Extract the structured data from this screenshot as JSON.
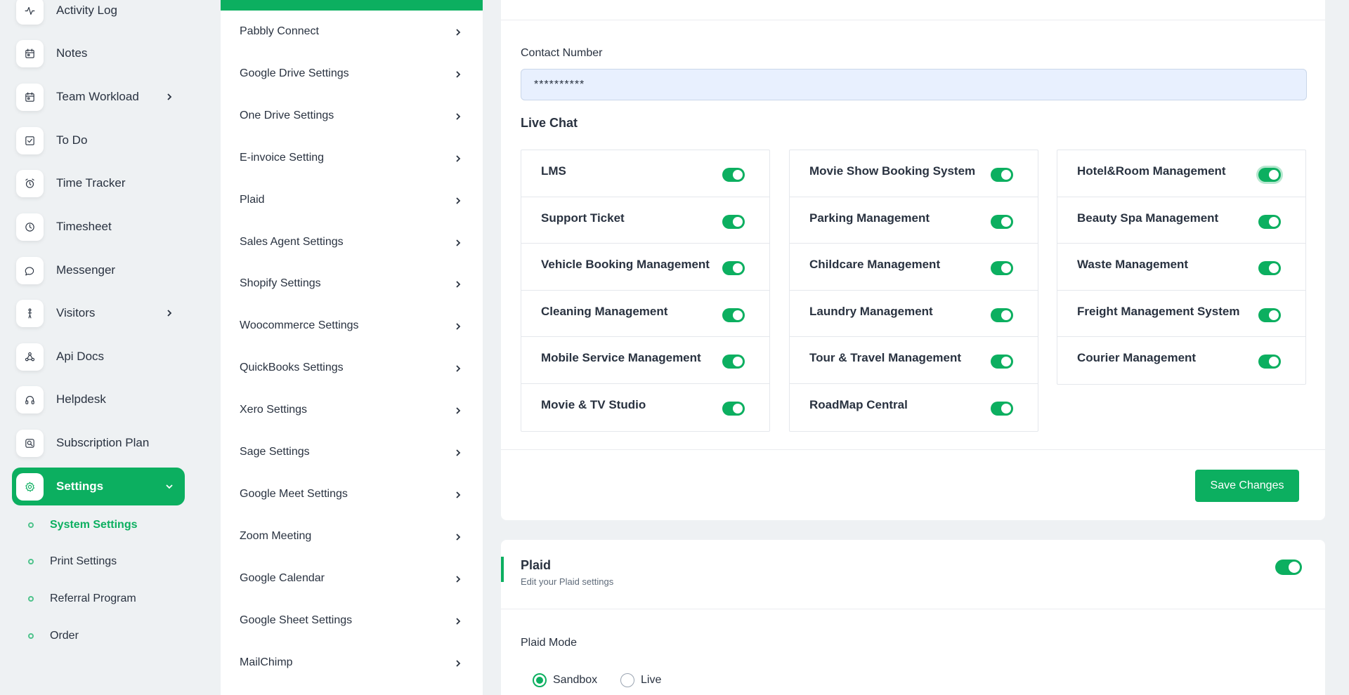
{
  "sidebar": {
    "items": [
      {
        "label": "Activity Log",
        "icon": "activity-icon"
      },
      {
        "label": "Notes",
        "icon": "calendar-icon"
      },
      {
        "label": "Team Workload",
        "icon": "calendar-icon"
      },
      {
        "label": "To Do",
        "icon": "checkbox-icon"
      },
      {
        "label": "Time Tracker",
        "icon": "alarm-clock-icon"
      },
      {
        "label": "Timesheet",
        "icon": "clock-icon"
      },
      {
        "label": "Messenger",
        "icon": "chat-bubble-icon"
      },
      {
        "label": "Visitors",
        "icon": "person-walking-icon"
      },
      {
        "label": "Api Docs",
        "icon": "share-nodes-icon"
      },
      {
        "label": "Helpdesk",
        "icon": "headphones-icon"
      },
      {
        "label": "Subscription Plan",
        "icon": "search-badge-icon"
      },
      {
        "label": "Settings",
        "icon": "gear-icon"
      }
    ],
    "sub_items": [
      {
        "label": "System Settings"
      },
      {
        "label": "Print Settings"
      },
      {
        "label": "Referral Program"
      },
      {
        "label": "Order"
      }
    ]
  },
  "settings_menu": {
    "items": [
      "Pabbly Connect",
      "Google Drive Settings",
      "One Drive Settings",
      "E-invoice Setting",
      "Plaid",
      "Sales Agent Settings",
      "Shopify Settings",
      "Woocommerce Settings",
      "QuickBooks Settings",
      "Xero Settings",
      "Sage Settings",
      "Google Meet Settings",
      "Zoom Meeting",
      "Google Calendar",
      "Google Sheet Settings",
      "MailChimp"
    ]
  },
  "main": {
    "contact": {
      "label": "Contact Number",
      "value": "**********"
    },
    "live_chat": {
      "title": "Live Chat",
      "columns": [
        [
          {
            "label": "LMS",
            "enabled": true
          },
          {
            "label": "Support Ticket",
            "enabled": true
          },
          {
            "label": "Vehicle Booking Management",
            "enabled": true
          },
          {
            "label": "Cleaning Management",
            "enabled": true
          },
          {
            "label": "Mobile Service Management",
            "enabled": true
          },
          {
            "label": "Movie & TV Studio",
            "enabled": true
          }
        ],
        [
          {
            "label": "Movie Show Booking System",
            "enabled": true
          },
          {
            "label": "Parking Management",
            "enabled": true
          },
          {
            "label": "Childcare Management",
            "enabled": true
          },
          {
            "label": "Laundry Management",
            "enabled": true
          },
          {
            "label": "Tour & Travel Management",
            "enabled": true
          },
          {
            "label": "RoadMap Central",
            "enabled": true
          }
        ],
        [
          {
            "label": "Hotel&Room Management",
            "enabled": true
          },
          {
            "label": "Beauty Spa Management",
            "enabled": true
          },
          {
            "label": "Waste Management",
            "enabled": true
          },
          {
            "label": "Freight Management System",
            "enabled": true
          },
          {
            "label": "Courier Management",
            "enabled": true
          }
        ]
      ]
    },
    "save_label": "Save Changes",
    "plaid": {
      "title": "Plaid",
      "subtitle": "Edit your Plaid settings",
      "enabled": true,
      "mode_label": "Plaid Mode",
      "modes": [
        {
          "label": "Sandbox",
          "checked": true
        },
        {
          "label": "Live",
          "checked": false
        }
      ]
    }
  },
  "colors": {
    "accent": "#0caf60",
    "background": "#eef1f3",
    "text": "#293240"
  }
}
